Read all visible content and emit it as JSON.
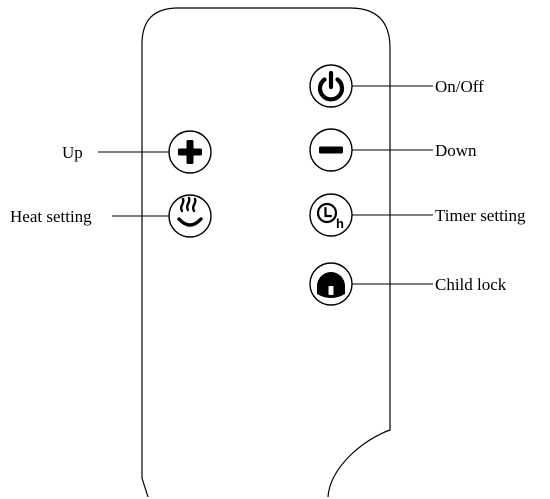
{
  "remote": {
    "buttons": [
      {
        "id": "on-off",
        "icon": "power-icon",
        "label": "On/Off",
        "interactable": true
      },
      {
        "id": "down",
        "icon": "minus-icon",
        "label": "Down",
        "interactable": true
      },
      {
        "id": "timer-setting",
        "icon": "timer-clock-icon",
        "icon_text": "h",
        "label": "Timer setting",
        "interactable": true
      },
      {
        "id": "child-lock",
        "icon": "padlock-icon",
        "label": "Child lock",
        "interactable": true
      },
      {
        "id": "up",
        "icon": "plus-icon",
        "label": "Up",
        "interactable": true
      },
      {
        "id": "heat-setting",
        "icon": "heat-waves-icon",
        "label": "Heat setting",
        "interactable": true
      }
    ]
  },
  "colors": {
    "ink": "#000000",
    "background": "#ffffff"
  }
}
